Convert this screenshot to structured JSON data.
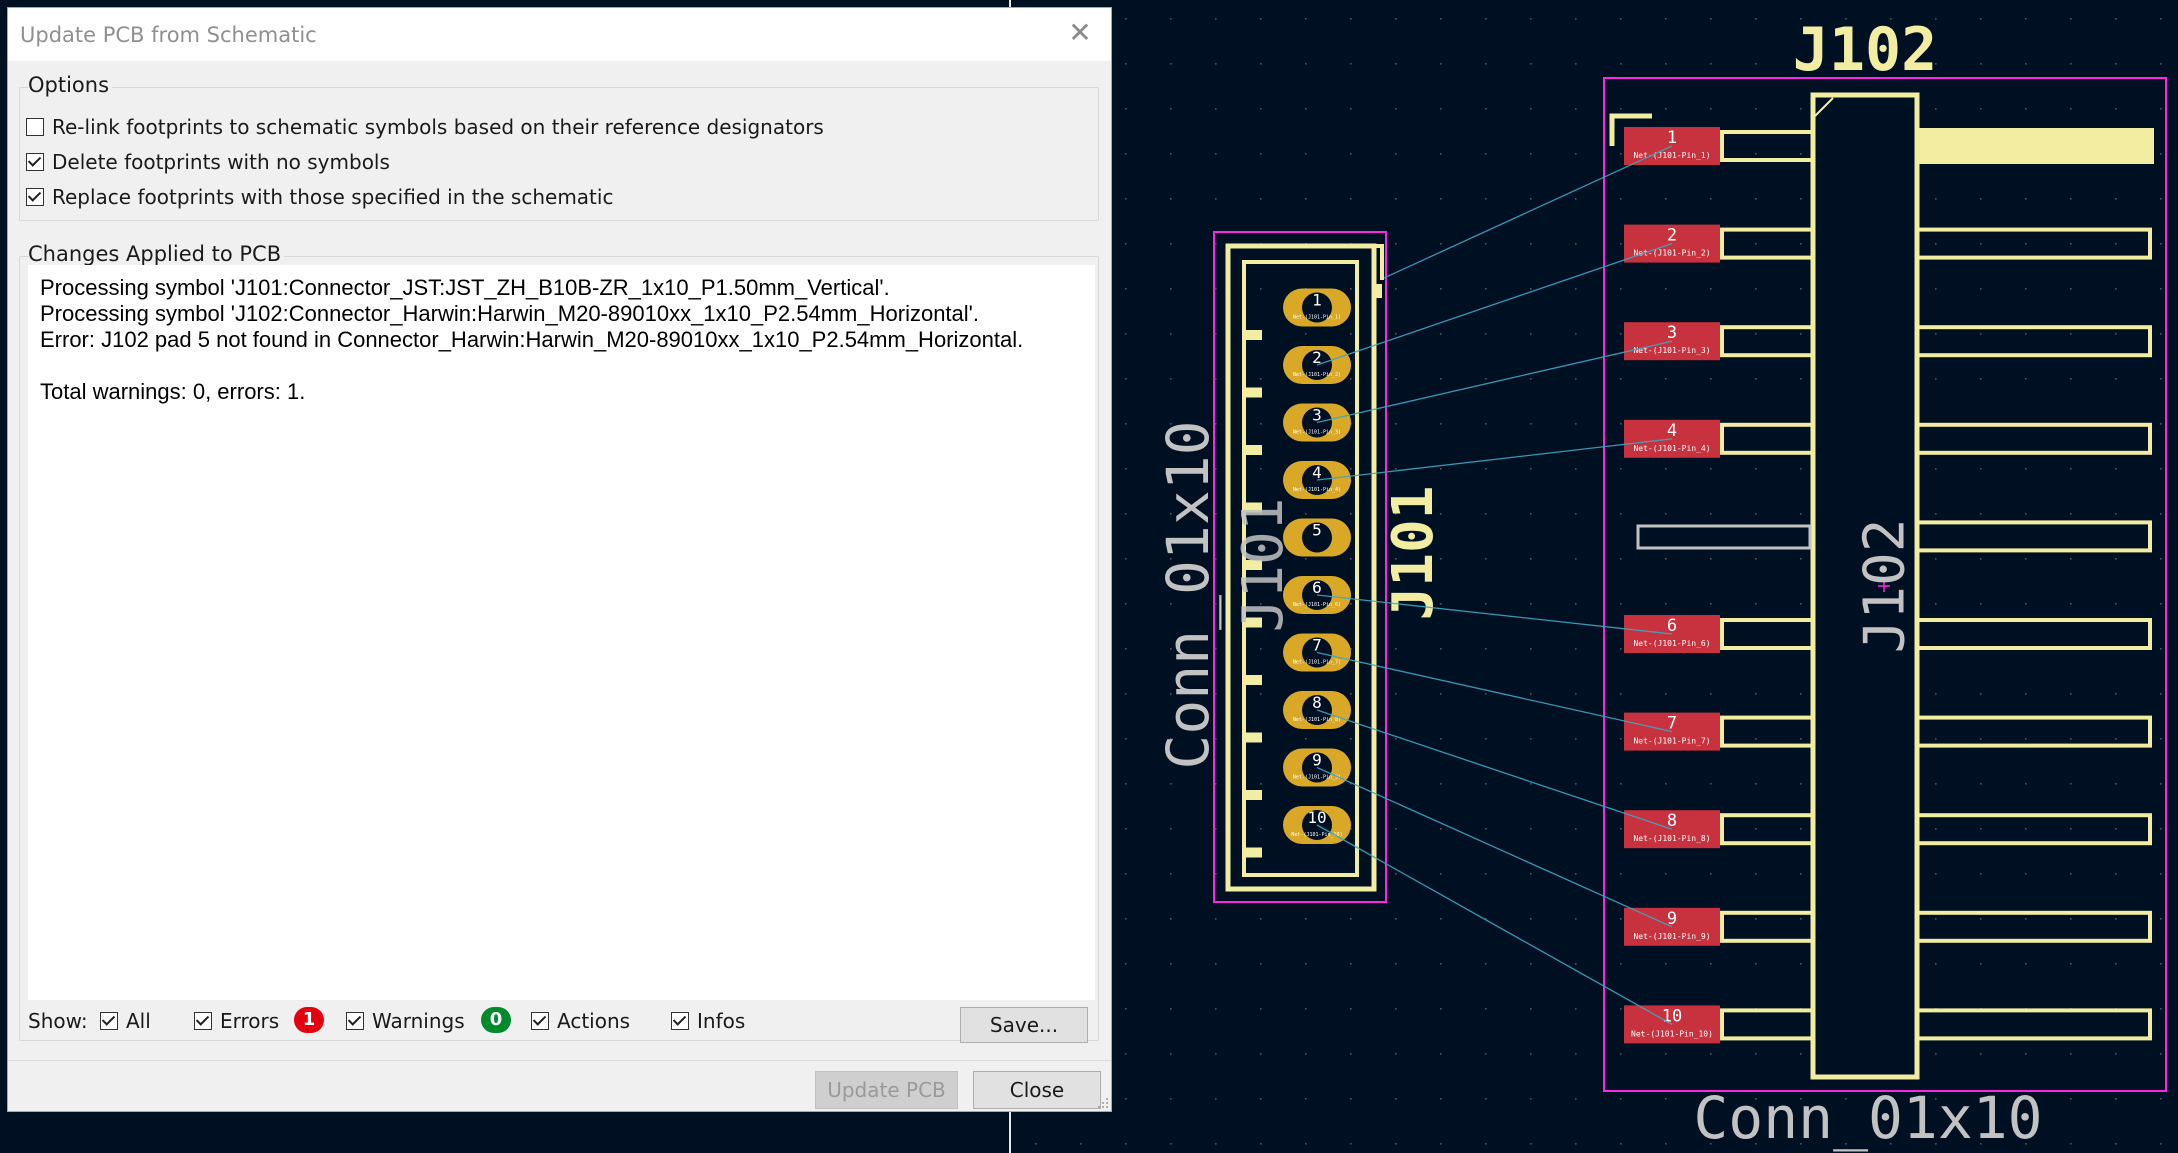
{
  "dialog": {
    "title": "Update PCB from Schematic",
    "options_label": "Options",
    "options": [
      {
        "label": "Re-link footprints to schematic symbols based on their reference designators",
        "checked": false
      },
      {
        "label": "Delete footprints with no symbols",
        "checked": true
      },
      {
        "label": "Replace footprints with those specified in the schematic",
        "checked": true
      }
    ],
    "changes_label": "Changes Applied to PCB",
    "log_lines": [
      "Processing symbol 'J101:Connector_JST:JST_ZH_B10B-ZR_1x10_P1.50mm_Vertical'.",
      "Processing symbol 'J102:Connector_Harwin:Harwin_M20-89010xx_1x10_P2.54mm_Horizontal'.",
      "Error: J102 pad 5 not found in Connector_Harwin:Harwin_M20-89010xx_1x10_P2.54mm_Horizontal.",
      "",
      "Total warnings: 0, errors: 1."
    ],
    "show": {
      "label": "Show:",
      "all": "All",
      "errors": "Errors",
      "errors_count": "1",
      "warnings": "Warnings",
      "warnings_count": "0",
      "actions": "Actions",
      "infos": "Infos"
    },
    "save_button": "Save...",
    "update_button": "Update PCB",
    "close_button": "Close",
    "colors": {
      "error_badge": "#e4000f",
      "warning_badge": "#008a2e"
    }
  },
  "pcb": {
    "j101": {
      "reference": "J101",
      "value": "Conn_01x10",
      "pads": [
        "1",
        "2",
        "3",
        "4",
        "5",
        "6",
        "7",
        "8",
        "9",
        "10"
      ],
      "pad_nets": [
        "Net-(J101-Pin_1)",
        "Net-(J101-Pin_2)",
        "Net-(J101-Pin_3)",
        "Net-(J101-Pin_4)",
        "",
        "Net-(J101-Pin_6)",
        "Net-(J101-Pin_7)",
        "Net-(J101-Pin_8)",
        "Net-(J101-Pin_9)",
        "Net-(J101-Pin_10)"
      ]
    },
    "j102": {
      "reference": "J102",
      "value": "Conn_01x10",
      "pads": [
        "1",
        "2",
        "3",
        "4",
        "6",
        "7",
        "8",
        "9",
        "10"
      ],
      "pad_nets": [
        "Net-(J101-Pin_1)",
        "Net-(J101-Pin_2)",
        "Net-(J101-Pin_3)",
        "Net-(J101-Pin_4)",
        "Net-(J101-Pin_6)",
        "Net-(J101-Pin_7)",
        "Net-(J101-Pin_8)",
        "Net-(J101-Pin_9)",
        "Net-(J101-Pin_10)"
      ]
    },
    "colors": {
      "background": "#001023",
      "silkscreen": "#f2eda1",
      "courtyard": "#ff26e2",
      "pad_copper": "#d9a826",
      "pad_smd": "#c8313e",
      "ratsnest": "#3fa6c2",
      "fab_text": "#c2c2c2"
    }
  }
}
